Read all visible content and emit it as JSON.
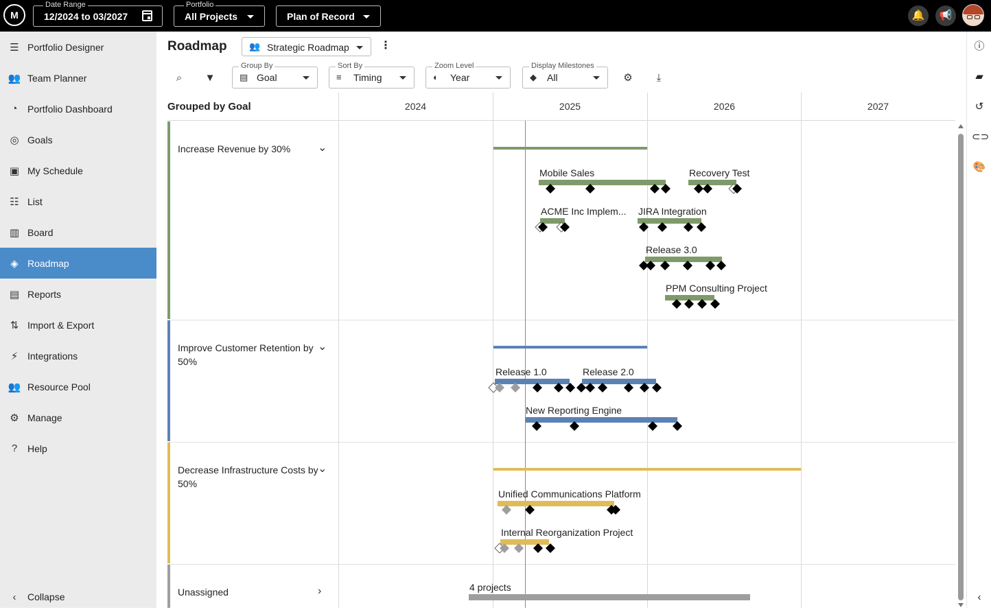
{
  "topbar": {
    "logo": "M",
    "date_range": {
      "label": "Date Range",
      "value": "12/2024 to 03/2027"
    },
    "portfolio": {
      "label": "Portfolio",
      "value": "All Projects"
    },
    "plan": {
      "value": "Plan of Record"
    },
    "icons": [
      "bell-icon",
      "megaphone-icon",
      "avatar"
    ]
  },
  "sidebar": {
    "items": [
      {
        "label": "Portfolio Designer",
        "icon": "portfolio-designer-icon",
        "glyph": "☰"
      },
      {
        "label": "Team Planner",
        "icon": "team-planner-icon",
        "glyph": "👥"
      },
      {
        "label": "Portfolio Dashboard",
        "icon": "dashboard-icon",
        "glyph": "◔"
      },
      {
        "label": "Goals",
        "icon": "target-icon",
        "glyph": "◎"
      },
      {
        "label": "My Schedule",
        "icon": "schedule-icon",
        "glyph": "▣"
      },
      {
        "label": "List",
        "icon": "list-icon",
        "glyph": "☷"
      },
      {
        "label": "Board",
        "icon": "board-icon",
        "glyph": "▥"
      },
      {
        "label": "Roadmap",
        "icon": "roadmap-icon",
        "glyph": "◈",
        "active": true
      },
      {
        "label": "Reports",
        "icon": "reports-icon",
        "glyph": "▤"
      },
      {
        "label": "Import & Export",
        "icon": "import-export-icon",
        "glyph": "⇅"
      },
      {
        "label": "Integrations",
        "icon": "plug-icon",
        "glyph": "⚡"
      },
      {
        "label": "Resource Pool",
        "icon": "people-icon",
        "glyph": "👥"
      },
      {
        "label": "Manage",
        "icon": "gear-icon",
        "glyph": "⚙"
      },
      {
        "label": "Help",
        "icon": "help-icon",
        "glyph": "?"
      }
    ],
    "collapse_label": "Collapse"
  },
  "header": {
    "title": "Roadmap",
    "view_select": "Strategic Roadmap"
  },
  "toolbar": {
    "group_by": {
      "label": "Group By",
      "value": "Goal"
    },
    "sort_by": {
      "label": "Sort By",
      "value": "Timing"
    },
    "zoom": {
      "label": "Zoom Level",
      "value": "Year"
    },
    "milestones": {
      "label": "Display Milestones",
      "value": "All"
    }
  },
  "roadmap": {
    "grouped_by_label": "Grouped by Goal",
    "years": [
      "2024",
      "2025",
      "2026",
      "2027"
    ],
    "goals": [
      {
        "name": "Increase Revenue by 30%",
        "color": "#7f9a6a",
        "expanded": true
      },
      {
        "name": "Improve Customer Retention by 50%",
        "color": "#5b82b5",
        "expanded": true
      },
      {
        "name": "Decrease Infrastructure Costs by 50%",
        "color": "#e0bb59",
        "expanded": true
      },
      {
        "name": "Unassigned",
        "color": "#9e9e9e",
        "expanded": false
      }
    ],
    "projects": [
      {
        "name": "Mobile Sales",
        "goal": 0
      },
      {
        "name": "Recovery Test",
        "goal": 0
      },
      {
        "name": "ACME Inc Implem...",
        "goal": 0
      },
      {
        "name": "JIRA Integration",
        "goal": 0
      },
      {
        "name": "Release 3.0",
        "goal": 0
      },
      {
        "name": "PPM Consulting Project",
        "goal": 0
      },
      {
        "name": "Release 1.0",
        "goal": 1
      },
      {
        "name": "Release 2.0",
        "goal": 1
      },
      {
        "name": "New Reporting Engine",
        "goal": 1
      },
      {
        "name": "Unified Communications Platform",
        "goal": 2
      },
      {
        "name": "Internal Reorganization Project",
        "goal": 2
      },
      {
        "name": "4 projects",
        "goal": 3
      }
    ]
  }
}
